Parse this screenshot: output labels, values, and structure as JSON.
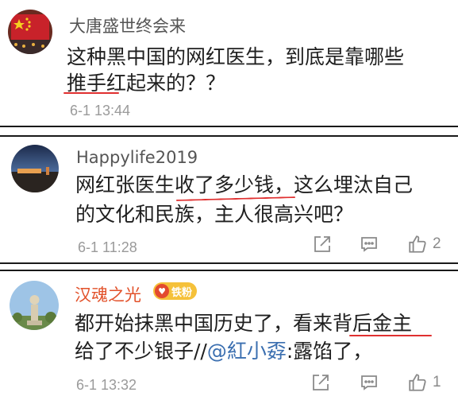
{
  "comments": [
    {
      "username": "大唐盛世终会来",
      "text_line1": "这种黑中国的网红医生，到底是靠哪些",
      "text_line2": "推手红起来的？？",
      "time": "6-1 13:44"
    },
    {
      "username": "Happylife2019",
      "text_line1": "网红张医生收了多少钱，这么埋汰自己",
      "text_line2": "的文化和民族，主人很高兴吧？",
      "time": "6-1 11:28",
      "like_count": "2"
    },
    {
      "username": "汉魂之光",
      "badge": "铁粉",
      "text_line1": "都开始抹黑中国历史了，看来背后金主",
      "text_line2_a": "给了不少银子//",
      "mention": "@紅小孬",
      "text_line2_b": ":露馅了，",
      "time": "6-1 13:32",
      "like_count": "1"
    }
  ],
  "icons": {
    "share": "share-icon",
    "comment": "comment-icon",
    "like": "thumbs-up-icon"
  },
  "colors": {
    "underline": "#e03030",
    "mention": "#3b6fb0",
    "vip_name": "#e2512a",
    "badge": "#f5c13a"
  }
}
